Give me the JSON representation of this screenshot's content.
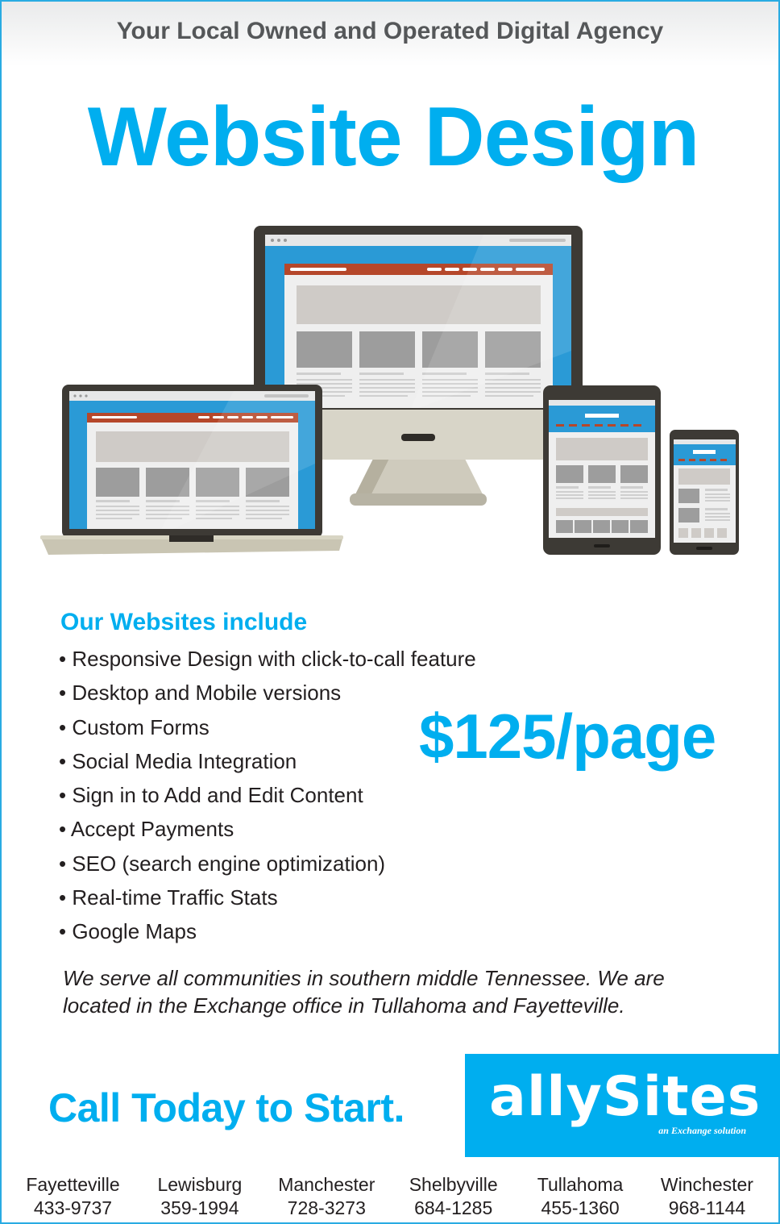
{
  "header": {
    "tagline": "Your Local Owned and Operated Digital Agency"
  },
  "hero": {
    "title": "Website Design"
  },
  "features": {
    "title": "Our Websites include",
    "items": [
      "• Responsive Design with click-to-call feature",
      "• Desktop and Mobile versions",
      "• Custom Forms",
      "• Social Media Integration",
      "• Sign in to Add and Edit Content",
      "• Accept Payments",
      "• SEO (search engine optimization)",
      "• Real-time Traffic Stats",
      "• Google Maps"
    ]
  },
  "price": "$125/page",
  "blurb": "We serve all communities in southern middle Tennessee. We are located in the Exchange office in Tullahoma and Fayetteville.",
  "cta": "Call Today to Start.",
  "logo": {
    "name": "allySites",
    "subtitle": "an Exchange solution"
  },
  "offices": [
    {
      "city": "Fayetteville",
      "phone": "433-9737"
    },
    {
      "city": "Lewisburg",
      "phone": "359-1994"
    },
    {
      "city": "Manchester",
      "phone": "728-3273"
    },
    {
      "city": "Shelbyville",
      "phone": "684-1285"
    },
    {
      "city": "Tullahoma",
      "phone": "455-1360"
    },
    {
      "city": "Winchester",
      "phone": "968-1144"
    }
  ],
  "colors": {
    "brand_blue": "#00aeef",
    "accent_red": "#b5472a",
    "text_dark": "#231f20"
  }
}
